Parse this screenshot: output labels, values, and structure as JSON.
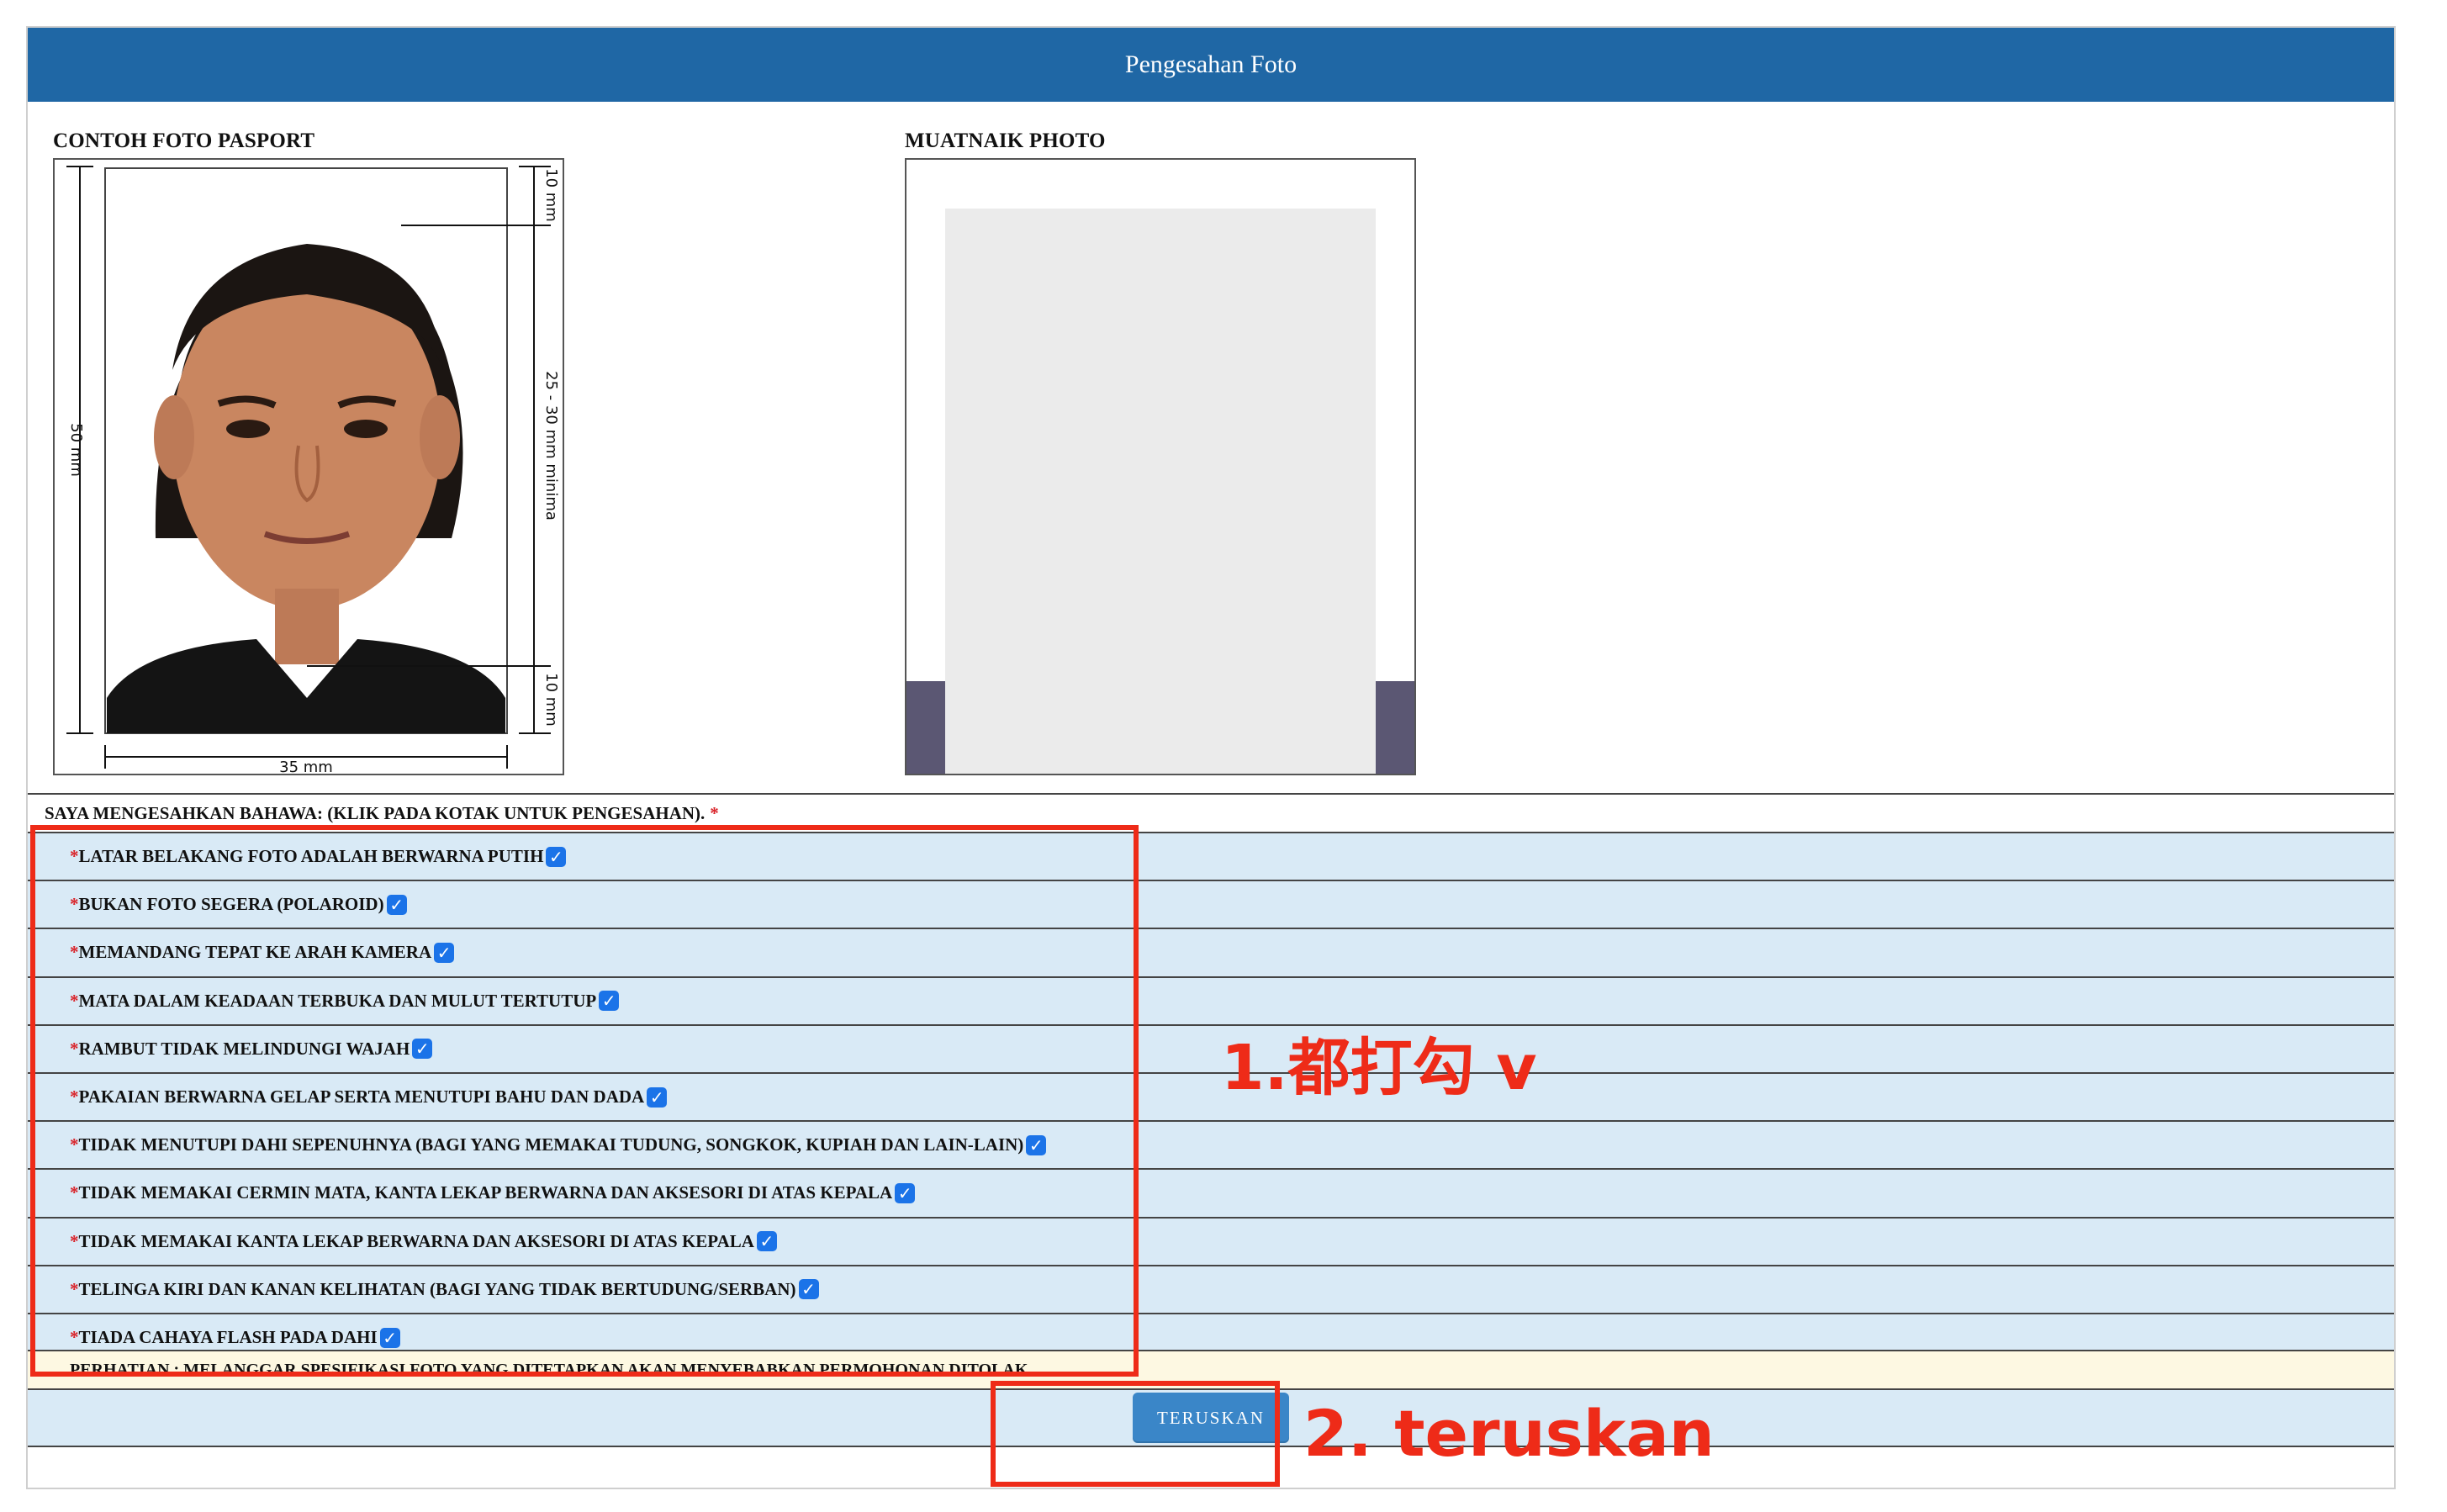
{
  "header": {
    "title": "Pengesahan Foto"
  },
  "sample": {
    "label": "CONTOH FOTO PASPORT",
    "dims": {
      "top": "10 mm",
      "middle": "25 - 30 mm minima",
      "bottom": "10 mm",
      "height": "50 mm",
      "width": "35 mm"
    }
  },
  "upload": {
    "label": "MUATNAIK PHOTO"
  },
  "confirm": {
    "header": "SAYA MENGESAHKAN BAHAWA: (KLIK PADA KOTAK UNTUK PENGESAHAN).",
    "required_mark": "*",
    "items": [
      {
        "label": "LATAR BELAKANG FOTO ADALAH BERWARNA PUTIH",
        "checked": true
      },
      {
        "label": "BUKAN FOTO SEGERA (POLAROID)",
        "checked": true
      },
      {
        "label": "MEMANDANG TEPAT KE ARAH KAMERA",
        "checked": true
      },
      {
        "label": "MATA DALAM KEADAAN TERBUKA DAN MULUT TERTUTUP",
        "checked": true
      },
      {
        "label": "RAMBUT TIDAK MELINDUNGI WAJAH",
        "checked": true
      },
      {
        "label": "PAKAIAN BERWARNA GELAP SERTA MENUTUPI BAHU DAN DADA",
        "checked": true
      },
      {
        "label": "TIDAK MENUTUPI DAHI SEPENUHNYA (BAGI YANG MEMAKAI TUDUNG, SONGKOK, KUPIAH DAN LAIN-LAIN)",
        "checked": true
      },
      {
        "label": "TIDAK MEMAKAI CERMIN MATA, KANTA LEKAP BERWARNA DAN AKSESORI DI ATAS KEPALA",
        "checked": true
      },
      {
        "label": "TIDAK MEMAKAI KANTA LEKAP BERWARNA DAN AKSESORI DI ATAS KEPALA",
        "checked": true
      },
      {
        "label": "TELINGA KIRI DAN KANAN KELIHATAN (BAGI YANG TIDAK BERTUDUNG/SERBAN)",
        "checked": true
      },
      {
        "label": "TIADA CAHAYA FLASH PADA DAHI",
        "checked": true
      }
    ],
    "notice": "PERHATIAN : MELANGGAR SPESIFIKASI FOTO YANG DITETAPKAN AKAN MENYEBABKAN PERMOHONAN DITOLAK."
  },
  "actions": {
    "continue_label": "TERUSKAN"
  },
  "annotations": {
    "step1": "1.都打勾 v",
    "step2": "2. teruskan",
    "color": "#ee2b18"
  },
  "colors": {
    "header_bg": "#1f67a5",
    "row_bg": "#d9eaf6",
    "notice_bg": "#fdf8e2",
    "checkbox": "#1b73e8"
  }
}
